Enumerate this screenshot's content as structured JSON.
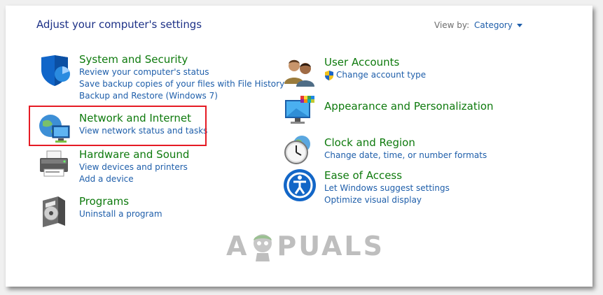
{
  "header": {
    "title": "Adjust your computer's settings",
    "view_by_label": "View by:",
    "view_by_value": "Category"
  },
  "categories": [
    {
      "title": "System and Security",
      "icon": "shield-icon",
      "links": [
        "Review your computer's status",
        "Save backup copies of your files with File History",
        "Backup and Restore (Windows 7)"
      ]
    },
    {
      "title": "Network and Internet",
      "icon": "network-globe-icon",
      "links": [
        "View network status and tasks"
      ],
      "highlighted": true
    },
    {
      "title": "Hardware and Sound",
      "icon": "printer-icon",
      "links": [
        "View devices and printers",
        "Add a device"
      ]
    },
    {
      "title": "Programs",
      "icon": "programs-disc-icon",
      "links": [
        "Uninstall a program"
      ]
    },
    {
      "title": "User Accounts",
      "icon": "users-icon",
      "links": [
        "Change account type"
      ]
    },
    {
      "title": "Appearance and Personalization",
      "icon": "monitor-palette-icon",
      "links": []
    },
    {
      "title": "Clock and Region",
      "icon": "clock-globe-icon",
      "links": [
        "Change date, time, or number formats"
      ]
    },
    {
      "title": "Ease of Access",
      "icon": "ease-of-access-icon",
      "links": [
        "Let Windows suggest settings",
        "Optimize visual display"
      ]
    }
  ],
  "watermark": {
    "text_left": "A",
    "text_right": "PUALS"
  },
  "colors": {
    "heading": "#1e3287",
    "category_title": "#0e7a0d",
    "link": "#1e5eaa",
    "highlight": "#e51b24"
  }
}
